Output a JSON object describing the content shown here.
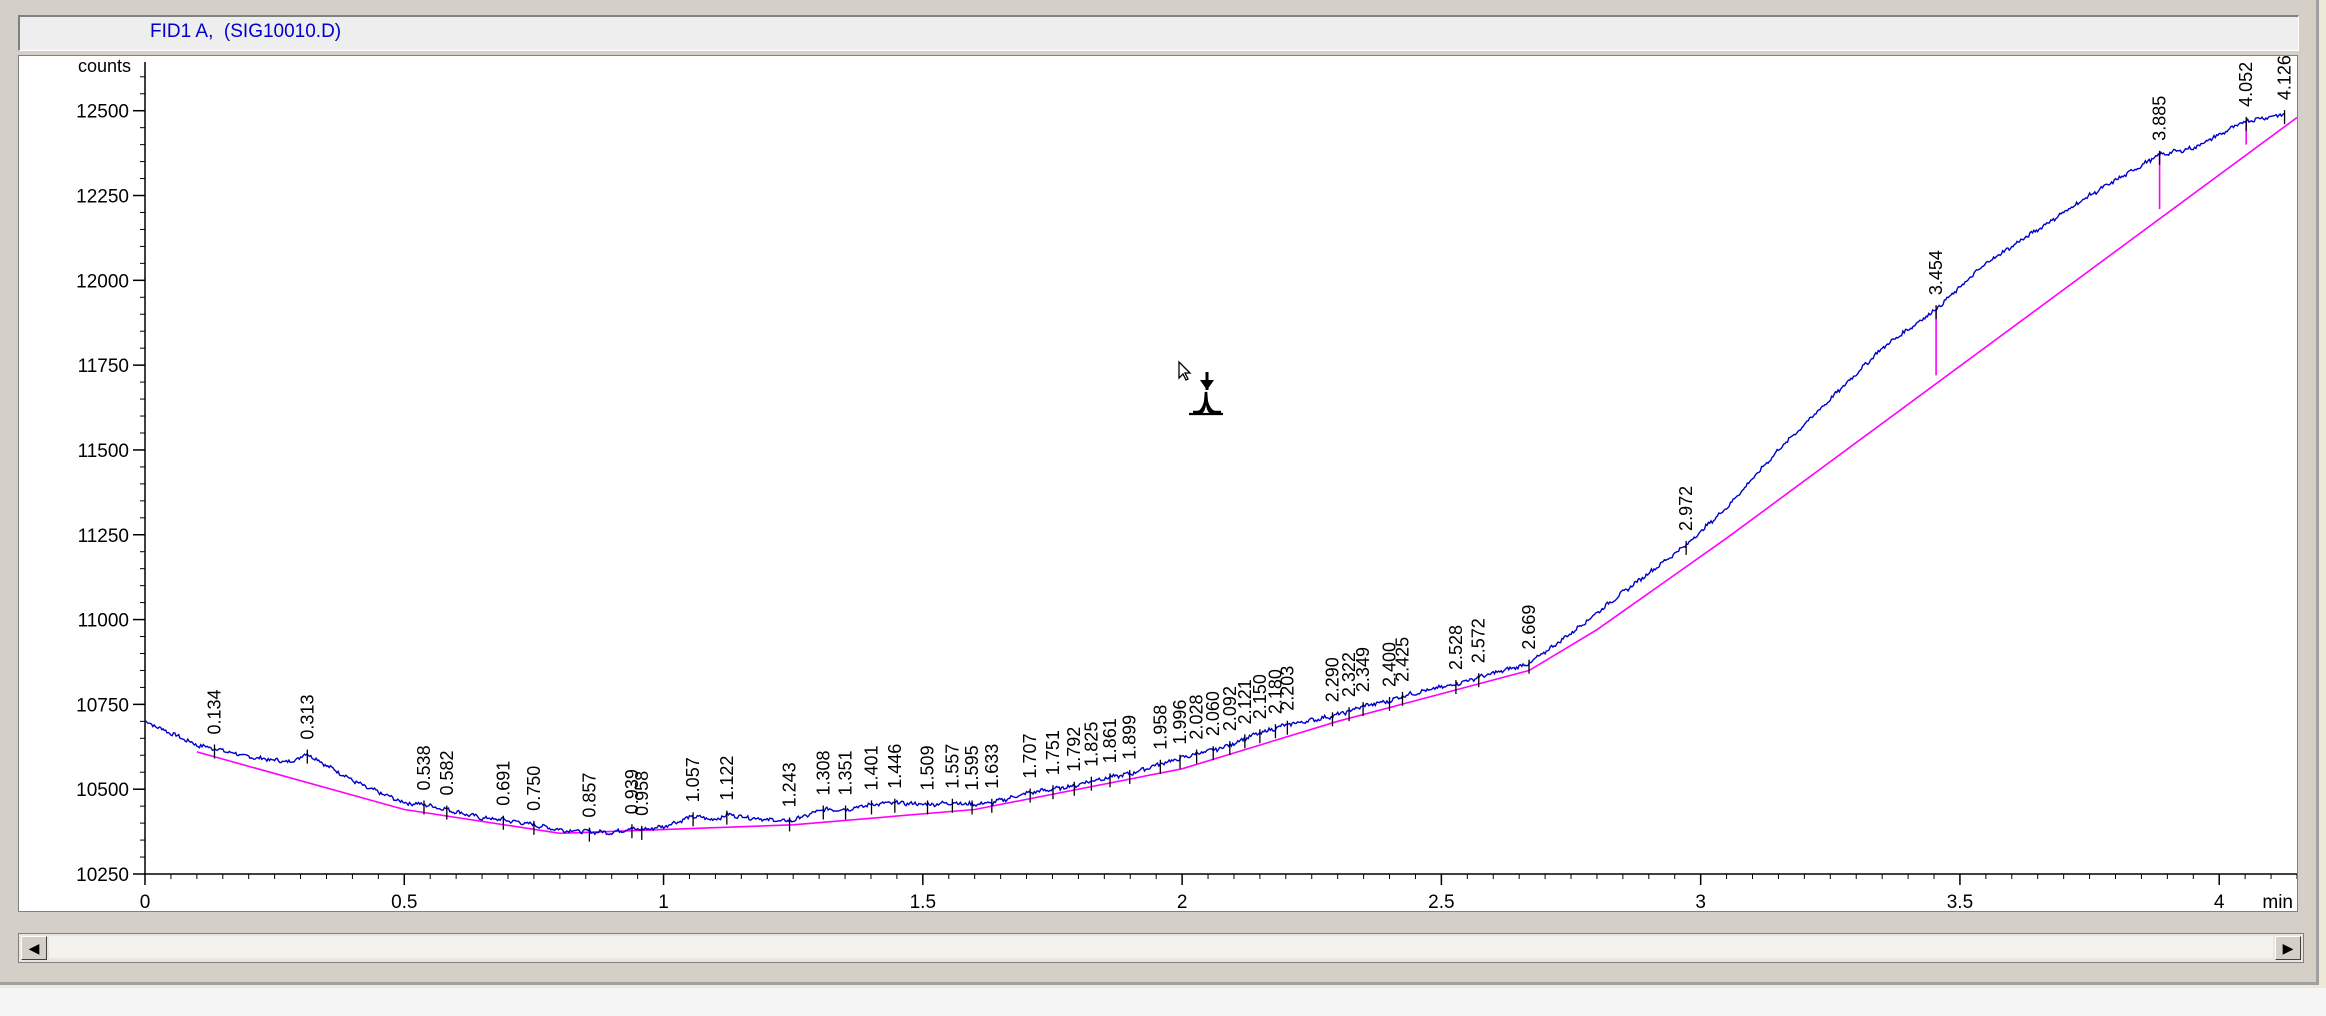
{
  "window": {
    "signal_title": "FID1 A,  (SIG10010.D)"
  },
  "colors": {
    "signal": "#0000cc",
    "baseline": "#ff00ff",
    "axis": "#000000",
    "title": "#0000cc"
  },
  "icons": [
    "pointer-cursor-icon",
    "integration-tool-icon",
    "scroll-left-icon",
    "scroll-right-icon"
  ],
  "chart_data": {
    "type": "line",
    "title": "",
    "ylabel": "counts",
    "xlabel": "min",
    "xlim": [
      0,
      4.15
    ],
    "ylim": [
      10250,
      12620
    ],
    "x_ticks": [
      0,
      0.5,
      1,
      1.5,
      2,
      2.5,
      3,
      3.5,
      4
    ],
    "x_tick_labels": [
      "0",
      "0.5",
      "1",
      "1.5",
      "2",
      "2.5",
      "3",
      "3.5",
      "4"
    ],
    "y_ticks": [
      10250,
      10500,
      10750,
      11000,
      11250,
      11500,
      11750,
      12000,
      12250,
      12500
    ],
    "y_tick_labels": [
      "10250",
      "10500",
      "10750",
      "11000",
      "11250",
      "11500",
      "11750",
      "12000",
      "12250",
      "12500"
    ],
    "grid": false,
    "legend": "none",
    "series": [
      {
        "type": "line",
        "x": [
          0,
          0.05,
          0.1,
          0.134,
          0.2,
          0.28,
          0.313,
          0.35,
          0.42,
          0.5,
          0.538,
          0.582,
          0.65,
          0.691,
          0.75,
          0.8,
          0.857,
          0.9,
          0.939,
          0.958,
          1.0,
          1.057,
          1.1,
          1.122,
          1.2,
          1.243,
          1.308,
          1.351,
          1.401,
          1.446,
          1.509,
          1.557,
          1.595,
          1.633,
          1.707,
          1.751,
          1.792,
          1.825,
          1.861,
          1.899,
          1.958,
          1.996,
          2.028,
          2.06,
          2.092,
          2.121,
          2.15,
          2.18,
          2.203,
          2.29,
          2.322,
          2.349,
          2.4,
          2.425,
          2.528,
          2.572,
          2.669,
          2.75,
          2.85,
          2.972,
          3.05,
          3.15,
          3.25,
          3.35,
          3.454,
          3.55,
          3.65,
          3.75,
          3.885,
          3.95,
          4.052,
          4.126
        ],
        "values": [
          10700,
          10665,
          10630,
          10620,
          10595,
          10580,
          10605,
          10570,
          10510,
          10460,
          10455,
          10440,
          10415,
          10410,
          10395,
          10380,
          10375,
          10372,
          10385,
          10380,
          10390,
          10420,
          10410,
          10425,
          10410,
          10405,
          10440,
          10440,
          10455,
          10460,
          10455,
          10460,
          10455,
          10460,
          10490,
          10500,
          10510,
          10525,
          10535,
          10545,
          10575,
          10590,
          10605,
          10615,
          10630,
          10650,
          10665,
          10680,
          10690,
          10715,
          10730,
          10745,
          10760,
          10775,
          10810,
          10830,
          10870,
          10960,
          11080,
          11220,
          11330,
          11500,
          11650,
          11800,
          11915,
          12050,
          12150,
          12250,
          12370,
          12390,
          12470,
          12490
        ]
      },
      {
        "type": "baseline",
        "x": [
          0.1,
          0.5,
          0.8,
          1.25,
          1.6,
          2.0,
          2.3,
          2.669,
          2.8,
          3.05,
          4.15
        ],
        "values": [
          10610,
          10440,
          10370,
          10395,
          10440,
          10560,
          10700,
          10850,
          10970,
          11240,
          12480
        ]
      }
    ],
    "peak_drop_lines": [
      {
        "x": 3.454,
        "from": 11915,
        "to": 11720
      },
      {
        "x": 3.885,
        "from": 12370,
        "to": 12210
      },
      {
        "x": 4.052,
        "from": 12470,
        "to": 12400
      }
    ],
    "annotations": [
      {
        "x": 0.134,
        "y": 10620,
        "text": "0.134"
      },
      {
        "x": 0.313,
        "y": 10605,
        "text": "0.313"
      },
      {
        "x": 0.538,
        "y": 10455,
        "text": "0.538"
      },
      {
        "x": 0.582,
        "y": 10440,
        "text": "0.582"
      },
      {
        "x": 0.691,
        "y": 10410,
        "text": "0.691"
      },
      {
        "x": 0.75,
        "y": 10395,
        "text": "0.750"
      },
      {
        "x": 0.857,
        "y": 10375,
        "text": "0.857"
      },
      {
        "x": 0.939,
        "y": 10385,
        "text": "0.939"
      },
      {
        "x": 0.958,
        "y": 10380,
        "text": "0.958"
      },
      {
        "x": 1.057,
        "y": 10420,
        "text": "1.057"
      },
      {
        "x": 1.122,
        "y": 10425,
        "text": "1.122"
      },
      {
        "x": 1.243,
        "y": 10405,
        "text": "1.243"
      },
      {
        "x": 1.308,
        "y": 10440,
        "text": "1.308"
      },
      {
        "x": 1.351,
        "y": 10440,
        "text": "1.351"
      },
      {
        "x": 1.401,
        "y": 10455,
        "text": "1.401"
      },
      {
        "x": 1.446,
        "y": 10460,
        "text": "1.446"
      },
      {
        "x": 1.509,
        "y": 10455,
        "text": "1.509"
      },
      {
        "x": 1.557,
        "y": 10460,
        "text": "1.557"
      },
      {
        "x": 1.595,
        "y": 10455,
        "text": "1.595"
      },
      {
        "x": 1.633,
        "y": 10460,
        "text": "1.633"
      },
      {
        "x": 1.707,
        "y": 10490,
        "text": "1.707"
      },
      {
        "x": 1.751,
        "y": 10500,
        "text": "1.751"
      },
      {
        "x": 1.792,
        "y": 10510,
        "text": "1.792"
      },
      {
        "x": 1.825,
        "y": 10525,
        "text": "1.825"
      },
      {
        "x": 1.861,
        "y": 10535,
        "text": "1.861"
      },
      {
        "x": 1.899,
        "y": 10545,
        "text": "1.899"
      },
      {
        "x": 1.958,
        "y": 10575,
        "text": "1.958"
      },
      {
        "x": 1.996,
        "y": 10590,
        "text": "1.996"
      },
      {
        "x": 2.028,
        "y": 10605,
        "text": "2.028"
      },
      {
        "x": 2.06,
        "y": 10615,
        "text": "2.060"
      },
      {
        "x": 2.092,
        "y": 10630,
        "text": "2.092"
      },
      {
        "x": 2.121,
        "y": 10650,
        "text": "2.121"
      },
      {
        "x": 2.15,
        "y": 10665,
        "text": "2.150"
      },
      {
        "x": 2.18,
        "y": 10680,
        "text": "2.180"
      },
      {
        "x": 2.203,
        "y": 10690,
        "text": "2.203"
      },
      {
        "x": 2.29,
        "y": 10715,
        "text": "2.290"
      },
      {
        "x": 2.322,
        "y": 10730,
        "text": "2.322"
      },
      {
        "x": 2.349,
        "y": 10745,
        "text": "2.349"
      },
      {
        "x": 2.4,
        "y": 10760,
        "text": "2.400"
      },
      {
        "x": 2.425,
        "y": 10775,
        "text": "2.425"
      },
      {
        "x": 2.528,
        "y": 10810,
        "text": "2.528"
      },
      {
        "x": 2.572,
        "y": 10830,
        "text": "2.572"
      },
      {
        "x": 2.669,
        "y": 10870,
        "text": "2.669"
      },
      {
        "x": 2.972,
        "y": 11220,
        "text": "2.972"
      },
      {
        "x": 3.454,
        "y": 11915,
        "text": "3.454"
      },
      {
        "x": 3.885,
        "y": 12370,
        "text": "3.885"
      },
      {
        "x": 4.052,
        "y": 12470,
        "text": "4.052"
      },
      {
        "x": 4.126,
        "y": 12490,
        "text": "4.126"
      }
    ]
  }
}
